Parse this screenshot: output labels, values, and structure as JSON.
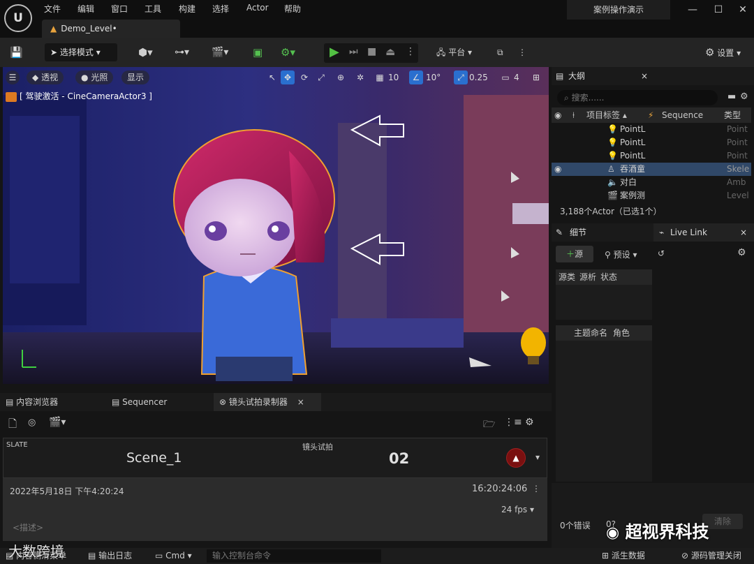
{
  "app": {
    "logo": "U",
    "menu": [
      "文件",
      "编辑",
      "窗口",
      "工具",
      "构建",
      "选择",
      "Actor",
      "帮助"
    ],
    "project_name": "案例操作演示",
    "tab": "Demo_Level•"
  },
  "toolbar": {
    "mode": "选择模式",
    "platform": "平台",
    "settings": "设置"
  },
  "viewport": {
    "perspective": "透视",
    "lit": "光照",
    "show": "显示",
    "grid": "10",
    "angle": "10°",
    "scale": "0.25",
    "cam_speed": "4",
    "pilot": "[ 驾驶激活 - CineCameraActor3 ]"
  },
  "outliner": {
    "title": "大纲",
    "search_placeholder": "搜索......",
    "col_label": "项目标签 ▴",
    "col_sequence": "Sequence",
    "col_type": "类型",
    "rows": [
      {
        "label": "PointL",
        "type": "Point"
      },
      {
        "label": "PointL",
        "type": "Point"
      },
      {
        "label": "PointL",
        "type": "Point"
      },
      {
        "label": "吞酒童",
        "type": "Skele"
      },
      {
        "label": "对白",
        "type": "Amb"
      },
      {
        "label": "案例测",
        "type": "Level"
      }
    ],
    "count": "3,188个Actor（已选1个）"
  },
  "details": {
    "tab": "细节",
    "livelink": "Live Link",
    "add_source": "源",
    "preset": "预设",
    "cols": [
      "源类",
      "源析",
      "状态"
    ],
    "cols2": [
      "主题命名",
      "角色"
    ],
    "errors": "0个错误",
    "clear": "清除",
    "err2": "0?"
  },
  "bottom": {
    "tab_content": "内容浏览器",
    "tab_seq": "Sequencer",
    "tab_take": "镜头试拍录制器",
    "slate_label": "SLATE",
    "slate": "Scene_1",
    "take_label": "镜头试拍",
    "take": "02",
    "date": "2022年5月18日 下午4:20:24",
    "timecode": "16:20:24:06",
    "fps": "24 fps",
    "desc": "<描述>"
  },
  "status": {
    "content": "内容侧滑菜单",
    "log": "输出日志",
    "cmd": "Cmd",
    "cmd_placeholder": "输入控制台命令",
    "derived": "派生数据",
    "source": "源码管理关闭"
  },
  "watermark": {
    "left": "大数跨境",
    "right": "超视界科技"
  }
}
